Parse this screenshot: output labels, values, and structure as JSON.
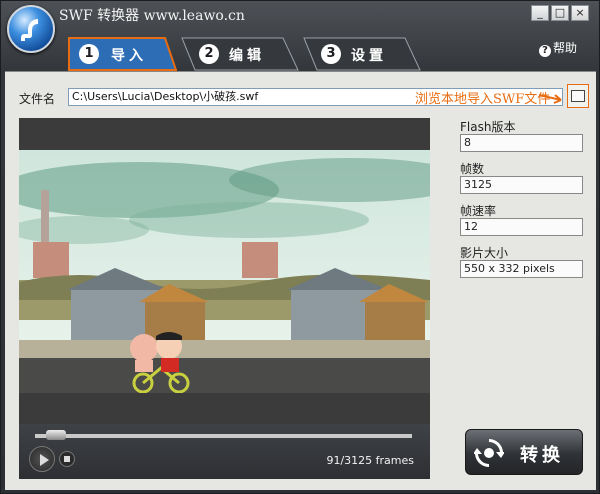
{
  "window": {
    "title": "SWF 转换器 www.leawo.cn",
    "min_label": "_",
    "max_label": "□",
    "close_label": "×"
  },
  "tabs": [
    {
      "num": "1",
      "label": "导入",
      "active": true
    },
    {
      "num": "2",
      "label": "编辑",
      "active": false
    },
    {
      "num": "3",
      "label": "设置",
      "active": false
    }
  ],
  "help": {
    "icon": "?",
    "label": "帮助"
  },
  "file": {
    "label": "文件名",
    "path": "C:\\Users\\Lucia\\Desktop\\小破孩.swf",
    "annotation": "浏览本地导入SWF文件"
  },
  "player": {
    "frames_text": "91/3125 frames",
    "progress": 0.03
  },
  "info": {
    "flash_version_label": "Flash版本",
    "flash_version": "8",
    "frame_count_label": "帧数",
    "frame_count": "3125",
    "frame_rate_label": "帧速率",
    "frame_rate": "12",
    "size_label": "影片大小",
    "size": "550 x 332 pixels"
  },
  "convert": {
    "label": "转换"
  },
  "colors": {
    "accent_orange": "#e86d12",
    "tab_active_border": "#e86d12",
    "tab_blue": "#2d6db5",
    "panel": "#e6e6e3"
  }
}
